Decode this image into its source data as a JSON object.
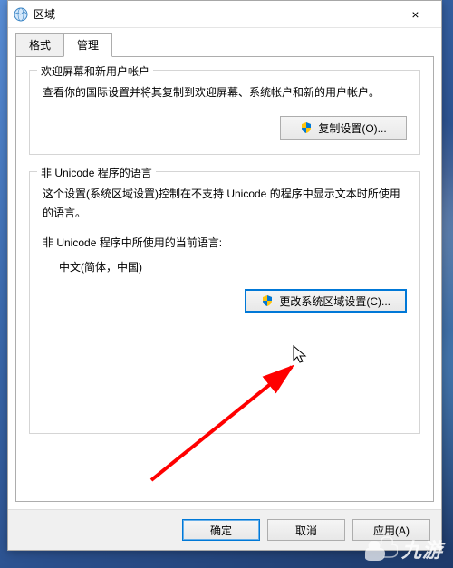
{
  "window": {
    "title": "区域",
    "close_label": "×"
  },
  "tabs": {
    "format": "格式",
    "admin": "管理"
  },
  "group1": {
    "title": "欢迎屏幕和新用户帐户",
    "text": "查看你的国际设置并将其复制到欢迎屏幕、系统帐户和新的用户帐户。",
    "copy_btn": "复制设置(O)..."
  },
  "group2": {
    "title": "非 Unicode 程序的语言",
    "text": "这个设置(系统区域设置)控制在不支持 Unicode 的程序中显示文本时所使用的语言。",
    "current_label": "非 Unicode 程序中所使用的当前语言:",
    "current_value": "中文(简体，中国)",
    "change_btn": "更改系统区域设置(C)..."
  },
  "buttons": {
    "ok": "确定",
    "cancel": "取消",
    "apply": "应用(A)"
  },
  "watermark": "九游"
}
